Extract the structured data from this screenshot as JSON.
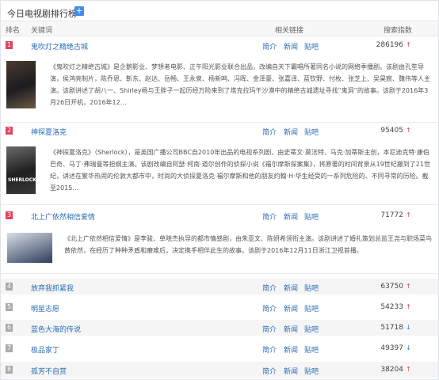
{
  "header": {
    "title": "今日电视剧排行榜",
    "add_icon": "plus-icon"
  },
  "columns": {
    "rank": "排名",
    "keyword": "关键词",
    "links": "相关链接",
    "index": "搜索指数"
  },
  "link_labels": [
    "简介",
    "新闻",
    "贴吧"
  ],
  "rows": [
    {
      "rank": "1",
      "title": "鬼吹灯之精绝古城",
      "index": "286196",
      "trend": "↑",
      "trend_dir": "up",
      "description": "《鬼吹灯之精绝古城》是企鹅影业、梦想者电影、正午阳光影业联合出品，改编自天下霸唱所著同名小说的网络季播剧。该剧由孔笙导演，侯鸿亮制片，陈乔恩、靳东、赵达、岳畅、王永泉、杨新鸣、冯晖、金泽豪、张嘉译、蓝钦野、付枚、张芝上、吴昊宸、魏伟等人主演。该剧讲述了胡八一、Shirley杨与王胖子一起历经万险来到了塔克拉玛干沙漠中的精绝古城遗址寻找“鬼洞”的故事。该剧于2016年3月26日开机，2016年12…"
    },
    {
      "rank": "2",
      "title": "神探夏洛克",
      "index": "95405",
      "trend": "↑",
      "trend_dir": "up",
      "poster_text": "SHERLOCK",
      "description": "《神探夏洛克》（Sherlock），是英国广播公司BBC自2010年出品的电视系列剧，由史蒂文·莫法特、马克·加蒂斯主创，本尼迪克特·康伯巴奇、马丁·弗瑞曼等担纲主演。该剧改编自阿瑟·柯南·道尔创作的侦探小说《福尔摩斯探案集》，将原著的时间背景从19世纪搬到了21世纪，讲述在繁华热闹的伦敦大都市中，时尚的大侦探夏洛克·福尔摩斯和他的朋友约翰·H·华生经受的一系列危险的、不同寻常的历险。截至2015…"
    },
    {
      "rank": "3",
      "title": "北上广依然相信爱情",
      "index": "71772",
      "trend": "↑",
      "trend_dir": "up",
      "description": "《北上广依然相信爱情》是李骏、单晓杰执导的都市情感剧，由朱亚文、陈妍希领衔主演。该剧讲述了婚礼策划总监王尧与职场菜鸟黄依然，在经历了种种矛盾和磨难后，决定携手相伴此生的故事。该剧于2016年12月11日浙江卫视首播。"
    },
    {
      "rank": "4",
      "title": "放弃我抓紧我",
      "index": "63750",
      "trend": "↑",
      "trend_dir": "up"
    },
    {
      "rank": "5",
      "title": "明星志愿",
      "index": "54233",
      "trend": "↑",
      "trend_dir": "up"
    },
    {
      "rank": "6",
      "title": "蓝色大海的传说",
      "index": "51718",
      "trend": "↓",
      "trend_dir": "down"
    },
    {
      "rank": "7",
      "title": "极品家丁",
      "index": "49397",
      "trend": "↓",
      "trend_dir": "down"
    },
    {
      "rank": "8",
      "title": "孤芳不自赏",
      "index": "38204",
      "trend": "↑",
      "trend_dir": "up"
    }
  ]
}
